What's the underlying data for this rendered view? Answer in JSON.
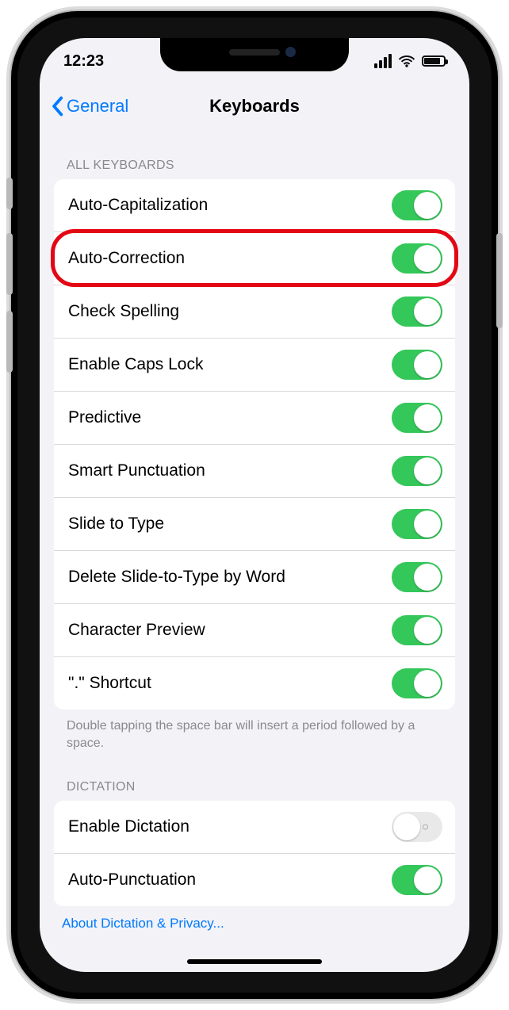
{
  "status": {
    "time": "12:23"
  },
  "nav": {
    "back": "General",
    "title": "Keyboards"
  },
  "sections": {
    "all_keyboards": {
      "header": "ALL KEYBOARDS",
      "rows": [
        {
          "label": "Auto-Capitalization",
          "on": true
        },
        {
          "label": "Auto-Correction",
          "on": true
        },
        {
          "label": "Check Spelling",
          "on": true
        },
        {
          "label": "Enable Caps Lock",
          "on": true
        },
        {
          "label": "Predictive",
          "on": true
        },
        {
          "label": "Smart Punctuation",
          "on": true
        },
        {
          "label": "Slide to Type",
          "on": true
        },
        {
          "label": "Delete Slide-to-Type by Word",
          "on": true
        },
        {
          "label": "Character Preview",
          "on": true
        },
        {
          "label": "\".\" Shortcut",
          "on": true
        }
      ],
      "footnote": "Double tapping the space bar will insert a period followed by a space."
    },
    "dictation": {
      "header": "DICTATION",
      "rows": [
        {
          "label": "Enable Dictation",
          "on": false
        },
        {
          "label": "Auto-Punctuation",
          "on": true
        }
      ],
      "link": "About Dictation & Privacy..."
    }
  },
  "highlight_row_index": 1
}
